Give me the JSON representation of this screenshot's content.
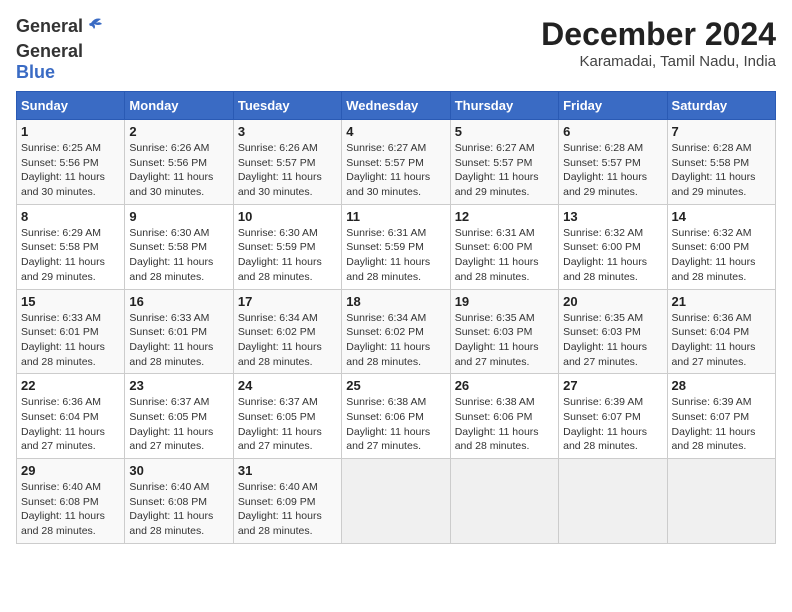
{
  "header": {
    "logo_line1": "General",
    "logo_line2": "Blue",
    "month_year": "December 2024",
    "location": "Karamadai, Tamil Nadu, India"
  },
  "weekdays": [
    "Sunday",
    "Monday",
    "Tuesday",
    "Wednesday",
    "Thursday",
    "Friday",
    "Saturday"
  ],
  "weeks": [
    [
      {
        "day": "1",
        "sunrise": "6:25 AM",
        "sunset": "5:56 PM",
        "daylight": "11 hours and 30 minutes."
      },
      {
        "day": "2",
        "sunrise": "6:26 AM",
        "sunset": "5:56 PM",
        "daylight": "11 hours and 30 minutes."
      },
      {
        "day": "3",
        "sunrise": "6:26 AM",
        "sunset": "5:57 PM",
        "daylight": "11 hours and 30 minutes."
      },
      {
        "day": "4",
        "sunrise": "6:27 AM",
        "sunset": "5:57 PM",
        "daylight": "11 hours and 30 minutes."
      },
      {
        "day": "5",
        "sunrise": "6:27 AM",
        "sunset": "5:57 PM",
        "daylight": "11 hours and 29 minutes."
      },
      {
        "day": "6",
        "sunrise": "6:28 AM",
        "sunset": "5:57 PM",
        "daylight": "11 hours and 29 minutes."
      },
      {
        "day": "7",
        "sunrise": "6:28 AM",
        "sunset": "5:58 PM",
        "daylight": "11 hours and 29 minutes."
      }
    ],
    [
      {
        "day": "8",
        "sunrise": "6:29 AM",
        "sunset": "5:58 PM",
        "daylight": "11 hours and 29 minutes."
      },
      {
        "day": "9",
        "sunrise": "6:30 AM",
        "sunset": "5:58 PM",
        "daylight": "11 hours and 28 minutes."
      },
      {
        "day": "10",
        "sunrise": "6:30 AM",
        "sunset": "5:59 PM",
        "daylight": "11 hours and 28 minutes."
      },
      {
        "day": "11",
        "sunrise": "6:31 AM",
        "sunset": "5:59 PM",
        "daylight": "11 hours and 28 minutes."
      },
      {
        "day": "12",
        "sunrise": "6:31 AM",
        "sunset": "6:00 PM",
        "daylight": "11 hours and 28 minutes."
      },
      {
        "day": "13",
        "sunrise": "6:32 AM",
        "sunset": "6:00 PM",
        "daylight": "11 hours and 28 minutes."
      },
      {
        "day": "14",
        "sunrise": "6:32 AM",
        "sunset": "6:00 PM",
        "daylight": "11 hours and 28 minutes."
      }
    ],
    [
      {
        "day": "15",
        "sunrise": "6:33 AM",
        "sunset": "6:01 PM",
        "daylight": "11 hours and 28 minutes."
      },
      {
        "day": "16",
        "sunrise": "6:33 AM",
        "sunset": "6:01 PM",
        "daylight": "11 hours and 28 minutes."
      },
      {
        "day": "17",
        "sunrise": "6:34 AM",
        "sunset": "6:02 PM",
        "daylight": "11 hours and 28 minutes."
      },
      {
        "day": "18",
        "sunrise": "6:34 AM",
        "sunset": "6:02 PM",
        "daylight": "11 hours and 28 minutes."
      },
      {
        "day": "19",
        "sunrise": "6:35 AM",
        "sunset": "6:03 PM",
        "daylight": "11 hours and 27 minutes."
      },
      {
        "day": "20",
        "sunrise": "6:35 AM",
        "sunset": "6:03 PM",
        "daylight": "11 hours and 27 minutes."
      },
      {
        "day": "21",
        "sunrise": "6:36 AM",
        "sunset": "6:04 PM",
        "daylight": "11 hours and 27 minutes."
      }
    ],
    [
      {
        "day": "22",
        "sunrise": "6:36 AM",
        "sunset": "6:04 PM",
        "daylight": "11 hours and 27 minutes."
      },
      {
        "day": "23",
        "sunrise": "6:37 AM",
        "sunset": "6:05 PM",
        "daylight": "11 hours and 27 minutes."
      },
      {
        "day": "24",
        "sunrise": "6:37 AM",
        "sunset": "6:05 PM",
        "daylight": "11 hours and 27 minutes."
      },
      {
        "day": "25",
        "sunrise": "6:38 AM",
        "sunset": "6:06 PM",
        "daylight": "11 hours and 27 minutes."
      },
      {
        "day": "26",
        "sunrise": "6:38 AM",
        "sunset": "6:06 PM",
        "daylight": "11 hours and 28 minutes."
      },
      {
        "day": "27",
        "sunrise": "6:39 AM",
        "sunset": "6:07 PM",
        "daylight": "11 hours and 28 minutes."
      },
      {
        "day": "28",
        "sunrise": "6:39 AM",
        "sunset": "6:07 PM",
        "daylight": "11 hours and 28 minutes."
      }
    ],
    [
      {
        "day": "29",
        "sunrise": "6:40 AM",
        "sunset": "6:08 PM",
        "daylight": "11 hours and 28 minutes."
      },
      {
        "day": "30",
        "sunrise": "6:40 AM",
        "sunset": "6:08 PM",
        "daylight": "11 hours and 28 minutes."
      },
      {
        "day": "31",
        "sunrise": "6:40 AM",
        "sunset": "6:09 PM",
        "daylight": "11 hours and 28 minutes."
      },
      null,
      null,
      null,
      null
    ]
  ]
}
